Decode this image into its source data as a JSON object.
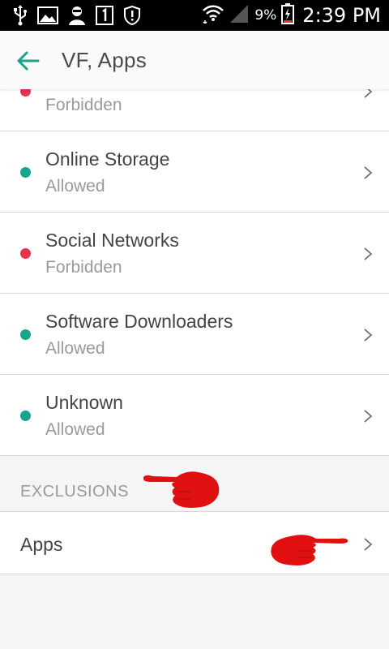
{
  "status_bar": {
    "battery_percent": "9%",
    "time": "2:39 PM",
    "icons": [
      "usb-icon",
      "image-icon",
      "avatar-icon",
      "sim-1-icon",
      "alert-shield-icon",
      "wifi-icon",
      "signal-icon",
      "battery-icon"
    ]
  },
  "app_bar": {
    "title": "VF, Apps",
    "back_icon": "arrow-back-icon"
  },
  "categories": [
    {
      "name": "",
      "status": "Forbidden",
      "dot_color": "#e8334a"
    },
    {
      "name": "Online Storage",
      "status": "Allowed",
      "dot_color": "#16a58a"
    },
    {
      "name": "Social Networks",
      "status": "Forbidden",
      "dot_color": "#e8334a"
    },
    {
      "name": "Software Downloaders",
      "status": "Allowed",
      "dot_color": "#16a58a"
    },
    {
      "name": "Unknown",
      "status": "Allowed",
      "dot_color": "#16a58a"
    }
  ],
  "exclusions": {
    "header": "EXCLUSIONS",
    "items": [
      {
        "label": "Apps"
      }
    ]
  },
  "colors": {
    "accent": "#16a58a",
    "allowed": "#16a58a",
    "forbidden": "#e8334a",
    "annotation": "#e01010"
  }
}
